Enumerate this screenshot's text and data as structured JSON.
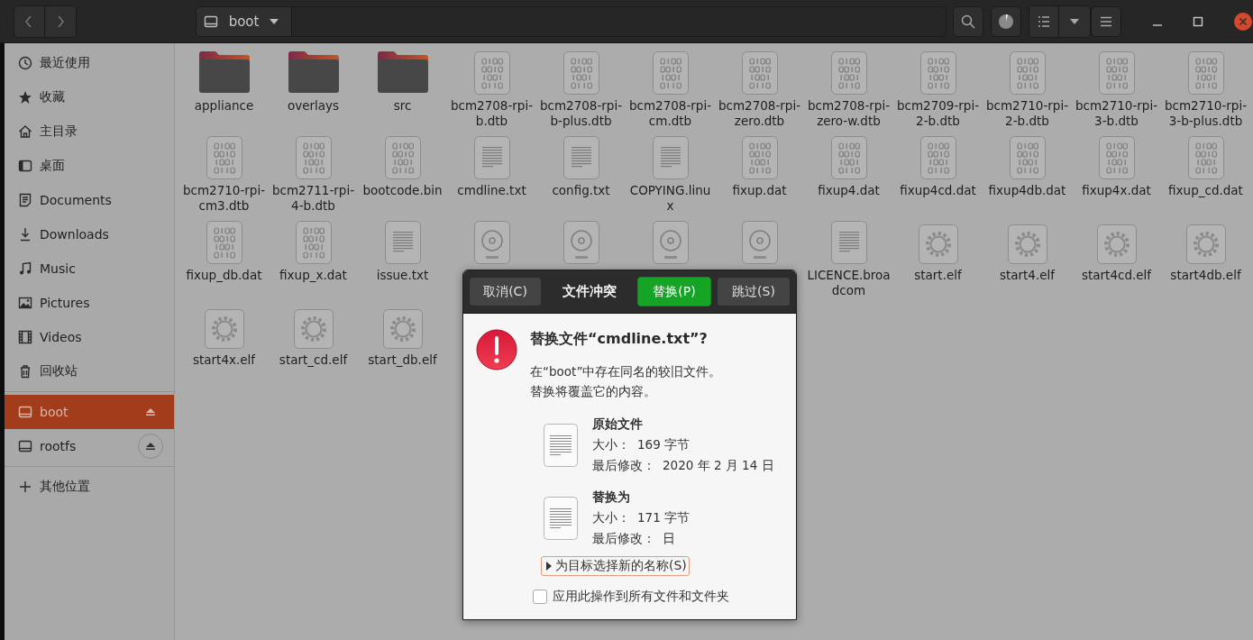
{
  "toolbar": {
    "location": "boot"
  },
  "sidebar": {
    "places": [
      {
        "label": "最近使用",
        "selected": false
      },
      {
        "label": "收藏",
        "selected": false
      },
      {
        "label": "主目录",
        "selected": false
      },
      {
        "label": "桌面",
        "selected": false
      },
      {
        "label": "Documents",
        "selected": false
      },
      {
        "label": "Downloads",
        "selected": false
      },
      {
        "label": "Music",
        "selected": false
      },
      {
        "label": "Pictures",
        "selected": false
      },
      {
        "label": "Videos",
        "selected": false
      },
      {
        "label": "回收站",
        "selected": false
      }
    ],
    "devices": [
      {
        "label": "boot",
        "selected": true
      },
      {
        "label": "rootfs",
        "selected": false
      }
    ],
    "other": [
      {
        "label": "其他位置",
        "selected": false
      }
    ]
  },
  "files": [
    {
      "name": "appliance",
      "kind": "folder"
    },
    {
      "name": "overlays",
      "kind": "folder"
    },
    {
      "name": "src",
      "kind": "folder"
    },
    {
      "name": "bcm2708-rpi-b.dtb",
      "kind": "binary"
    },
    {
      "name": "bcm2708-rpi-b-plus.dtb",
      "kind": "binary"
    },
    {
      "name": "bcm2708-rpi-cm.dtb",
      "kind": "binary"
    },
    {
      "name": "bcm2708-rpi-zero.dtb",
      "kind": "binary"
    },
    {
      "name": "bcm2708-rpi-zero-w.dtb",
      "kind": "binary"
    },
    {
      "name": "bcm2709-rpi-2-b.dtb",
      "kind": "binary"
    },
    {
      "name": "bcm2710-rpi-2-b.dtb",
      "kind": "binary"
    },
    {
      "name": "bcm2710-rpi-3-b.dtb",
      "kind": "binary"
    },
    {
      "name": "bcm2710-rpi-3-b-plus.dtb",
      "kind": "binary"
    },
    {
      "name": "bcm2710-rpi-cm3.dtb",
      "kind": "binary"
    },
    {
      "name": "bcm2711-rpi-4-b.dtb",
      "kind": "binary"
    },
    {
      "name": "bootcode.bin",
      "kind": "binary"
    },
    {
      "name": "cmdline.txt",
      "kind": "text"
    },
    {
      "name": "config.txt",
      "kind": "text"
    },
    {
      "name": "COPYING.linux",
      "kind": "text"
    },
    {
      "name": "fixup.dat",
      "kind": "binary"
    },
    {
      "name": "fixup4.dat",
      "kind": "binary"
    },
    {
      "name": "fixup4cd.dat",
      "kind": "binary"
    },
    {
      "name": "fixup4db.dat",
      "kind": "binary"
    },
    {
      "name": "fixup4x.dat",
      "kind": "binary"
    },
    {
      "name": "fixup_cd.dat",
      "kind": "binary"
    },
    {
      "name": "fixup_db.dat",
      "kind": "binary"
    },
    {
      "name": "fixup_x.dat",
      "kind": "binary"
    },
    {
      "name": "issue.txt",
      "kind": "text"
    },
    {
      "kind": "disc"
    },
    {
      "kind": "disc"
    },
    {
      "kind": "disc"
    },
    {
      "kind": "disc"
    },
    {
      "name": "LICENCE.broadcom",
      "kind": "text"
    },
    {
      "name": "start.elf",
      "kind": "executable"
    },
    {
      "name": "start4.elf",
      "kind": "executable"
    },
    {
      "name": "start4cd.elf",
      "kind": "executable"
    },
    {
      "name": "start4db.elf",
      "kind": "executable"
    },
    {
      "name": "start4x.elf",
      "kind": "executable"
    },
    {
      "name": "start_cd.elf",
      "kind": "executable"
    },
    {
      "name": "start_db.elf",
      "kind": "executable"
    }
  ],
  "dialog": {
    "cancel": "取消(C)",
    "title": "文件冲突",
    "actions": [
      {
        "label": "替换(P)",
        "kind": "suggested"
      },
      {
        "label": "跳过(S)",
        "kind": "normal"
      }
    ],
    "heading": "替换文件“cmdline.txt”?",
    "message": [
      "在“boot”中存在同名的较旧文件。",
      "替换将覆盖它的内容。"
    ],
    "files": [
      {
        "heading": "原始文件",
        "size_label": "大小：",
        "size": "169 字节",
        "date_label": "最后修改：",
        "date": "2020 年 2 月 14 日"
      },
      {
        "heading": "替换为",
        "size_label": "大小：",
        "size": "171 字节",
        "date_label": "最后修改：",
        "date": "日"
      }
    ],
    "expander": {
      "label": "为目标选择新的名称(S)",
      "expanded": false
    },
    "apply_all": {
      "label": "应用此操作到所有文件和文件夹",
      "checked": false
    }
  }
}
